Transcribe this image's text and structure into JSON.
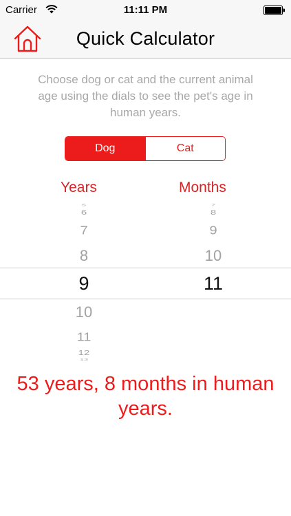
{
  "status_bar": {
    "carrier": "Carrier",
    "time": "11:11 PM"
  },
  "nav": {
    "title": "Quick Calculator",
    "home_icon": "house-icon"
  },
  "instructions": "Choose dog or cat and the current animal age using the dials to see the pet's age in human years.",
  "segmented": {
    "options": [
      "Dog",
      "Cat"
    ],
    "selected": "Dog"
  },
  "picker": {
    "years_label": "Years",
    "months_label": "Months",
    "years": {
      "above": [
        "5",
        "6",
        "7",
        "8"
      ],
      "selected": "9",
      "below": [
        "10",
        "11",
        "12",
        "13"
      ]
    },
    "months": {
      "above": [
        "7",
        "8",
        "9",
        "10"
      ],
      "selected": "11",
      "below": []
    }
  },
  "result": "53 years, 8 months in human years.",
  "colors": {
    "accent": "#ec1c1c",
    "placeholder_text": "#a8a8a8",
    "picker_inactive": "#a2a2a2"
  }
}
